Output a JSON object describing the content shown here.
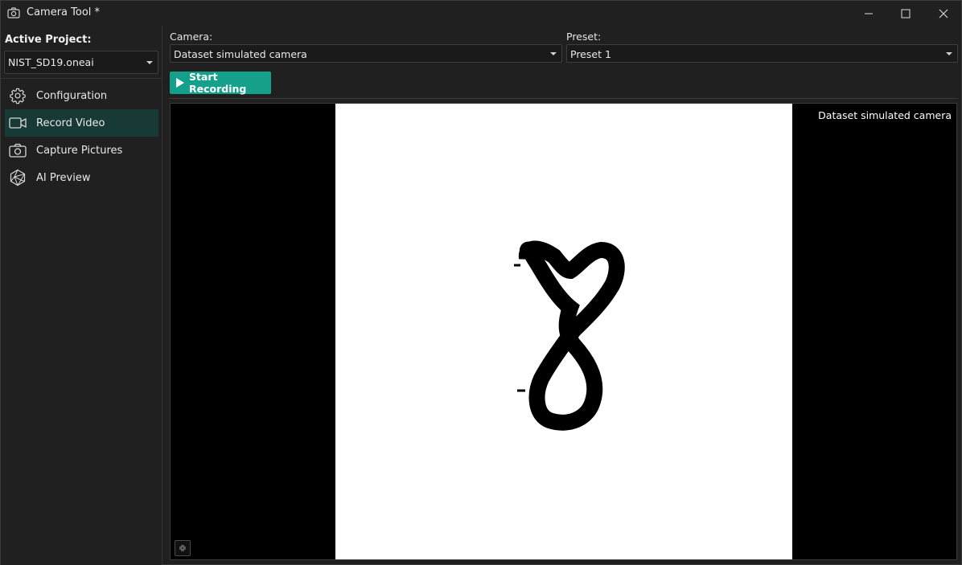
{
  "window": {
    "title": "Camera Tool *",
    "controls": [
      "minimize-icon",
      "maximize-icon",
      "close-icon"
    ]
  },
  "sidebar": {
    "project_label": "Active Project:",
    "project_value": "NIST_SD19.oneai",
    "items": [
      {
        "label": "Configuration",
        "icon": "gear-icon",
        "active": false
      },
      {
        "label": "Record Video",
        "icon": "video-camera-icon",
        "active": true
      },
      {
        "label": "Capture Pictures",
        "icon": "camera-icon",
        "active": false
      },
      {
        "label": "AI Preview",
        "icon": "ai-network-icon",
        "active": false
      }
    ]
  },
  "main": {
    "camera_label": "Camera:",
    "camera_value": "Dataset simulated camera",
    "preset_label": "Preset:",
    "preset_value": "Preset 1",
    "start_button": "Start Recording",
    "viewer_overlay": "Dataset simulated camera",
    "fit_icon": "fit-view-icon"
  },
  "colors": {
    "accent": "#14a08a",
    "active_nav": "#183a36",
    "background": "#202020"
  }
}
